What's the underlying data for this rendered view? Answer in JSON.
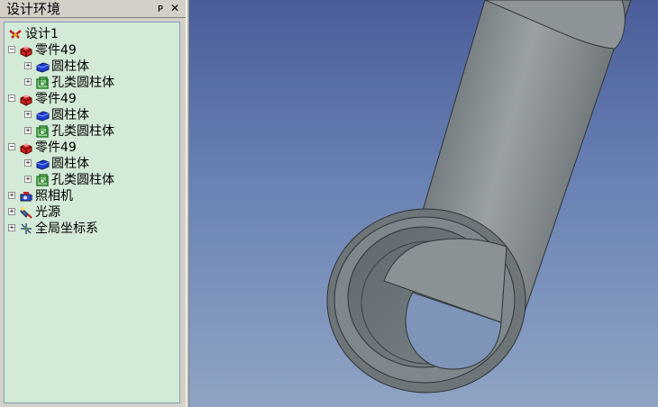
{
  "panel": {
    "title": "设计环境",
    "pin_glyph": "ᴘ",
    "close_glyph": "✕"
  },
  "tree": {
    "root": {
      "label": "设计1",
      "icon": "design-root-icon"
    },
    "parts": [
      {
        "label": "零件49",
        "icon": "part-icon",
        "children": [
          {
            "label": "圆柱体",
            "icon": "cylinder-solid-icon"
          },
          {
            "label": "孔类圆柱体",
            "icon": "hole-cylinder-icon"
          }
        ]
      },
      {
        "label": "零件49",
        "icon": "part-icon",
        "children": [
          {
            "label": "圆柱体",
            "icon": "cylinder-solid-icon"
          },
          {
            "label": "孔类圆柱体",
            "icon": "hole-cylinder-icon"
          }
        ]
      },
      {
        "label": "零件49",
        "icon": "part-icon",
        "children": [
          {
            "label": "圆柱体",
            "icon": "cylinder-solid-icon"
          },
          {
            "label": "孔类圆柱体",
            "icon": "hole-cylinder-icon"
          }
        ]
      }
    ],
    "extras": [
      {
        "label": "照相机",
        "icon": "camera-icon"
      },
      {
        "label": "光源",
        "icon": "light-source-icon"
      },
      {
        "label": "全局坐标系",
        "icon": "global-axes-icon"
      }
    ],
    "expander_symbols": {
      "collapsed": "+",
      "expanded": "−"
    }
  },
  "colors": {
    "tree_background": "#d3ead6",
    "viewport_top": "#4a5d9a",
    "viewport_bottom": "#8fa4c4",
    "part_red": "#cc2222",
    "solid_blue": "#1f3fcf",
    "hole_green": "#2a7a2a"
  }
}
